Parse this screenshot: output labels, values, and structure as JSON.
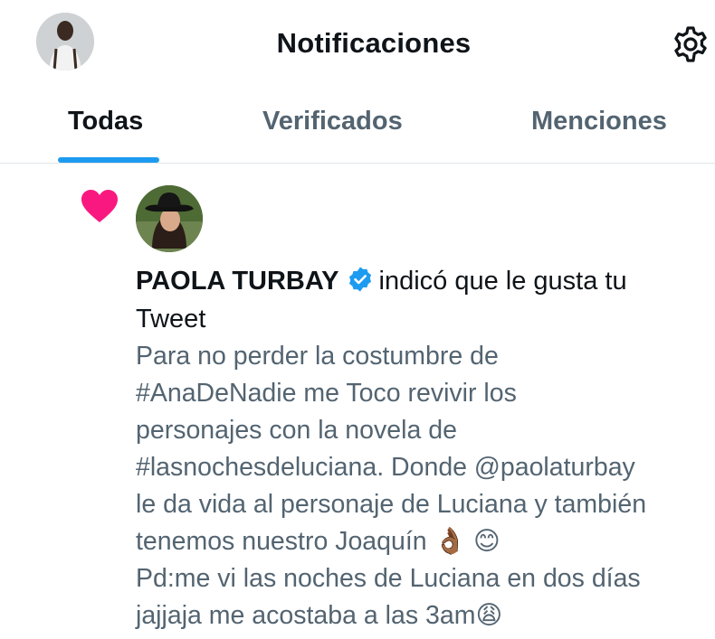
{
  "header": {
    "title": "Notificaciones",
    "settings_icon": "gear-icon"
  },
  "tabs": [
    {
      "label": "Todas",
      "active": true
    },
    {
      "label": "Verificados",
      "active": false
    },
    {
      "label": "Menciones",
      "active": false
    }
  ],
  "notification": {
    "type_icon": "heart-icon",
    "user_name": "PAOLA TURBAY",
    "verified": true,
    "action_text": "indicó que le gusta tu",
    "action_object": "Tweet",
    "tweet_lines": [
      "Para no perder la costumbre de",
      "#AnaDeNadie me Toco  revivir los",
      "personajes con la novela de",
      "#lasnochesdeluciana. Donde @paolaturbay",
      "le da vida al personaje de Luciana y también",
      "tenemos nuestro Joaquín 👌🏾 😊",
      "Pd:me vi las noches de Luciana en dos días",
      "jajjaja me acostaba a las 3am😩"
    ]
  },
  "colors": {
    "accent": "#1d9bf0",
    "heart": "#f91880",
    "secondary_text": "#536471",
    "primary_text": "#0f1419"
  }
}
